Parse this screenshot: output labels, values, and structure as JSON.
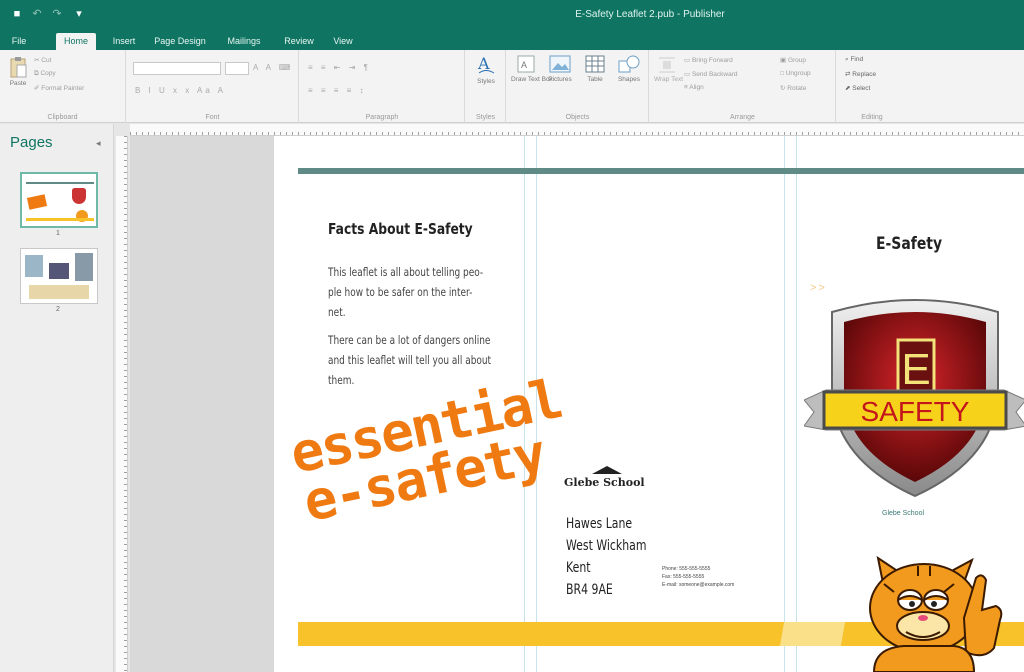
{
  "window": {
    "title": "E-Safety Leaflet 2.pub - Publisher"
  },
  "tabs": [
    "File",
    "Home",
    "Insert",
    "Page Design",
    "Mailings",
    "Review",
    "View"
  ],
  "active_tab": "Home",
  "ribbon": {
    "clipboard": {
      "paste": "Paste",
      "cut": "Cut",
      "copy": "Copy",
      "format_painter": "Format Painter",
      "label": "Clipboard"
    },
    "font": {
      "label": "Font"
    },
    "paragraph": {
      "label": "Paragraph"
    },
    "styles": {
      "button": "Styles",
      "label": "Styles"
    },
    "objects": {
      "draw_text_box": "Draw Text Box",
      "pictures": "Pictures",
      "table": "Table",
      "shapes": "Shapes",
      "label": "Objects"
    },
    "arrange": {
      "wrap_text": "Wrap Text",
      "bring_forward": "Bring Forward",
      "send_backward": "Send Backward",
      "align": "Align",
      "group": "Group",
      "ungroup": "Ungroup",
      "rotate": "Rotate",
      "label": "Arrange"
    },
    "editing": {
      "find": "Find",
      "replace": "Replace",
      "select": "Select",
      "label": "Editing"
    }
  },
  "pages_pane": {
    "title": "Pages",
    "pages": [
      {
        "number": "1"
      },
      {
        "number": "2"
      }
    ]
  },
  "leaflet": {
    "facts_title": "Facts About E-Safety",
    "para1": "This leaflet is all about telling peo- ple how to be safer on the inter- net.",
    "para2": "There can be a lot of dangers online and this leaflet will tell you all about them.",
    "essential_line1": "essential",
    "essential_line2": "e-safety",
    "school_name": "Glebe School",
    "address": [
      "Hawes Lane",
      "West Wickham",
      "Kent",
      "BR4 9AE"
    ],
    "contact": [
      "Phone: 555-555-5555",
      "Fax: 555-555-5555",
      "E-mail: someone@example.com"
    ],
    "esafety_title": "E-Safety",
    "arrows": ">>",
    "badge_letter": "E",
    "badge_word": "SAFETY",
    "school_small": "Glebe School"
  },
  "colors": {
    "brand": "#0f7562",
    "accent_orange": "#f07a12",
    "accent_yellow": "#f7c22a",
    "bar_teal": "#5f8a86"
  }
}
